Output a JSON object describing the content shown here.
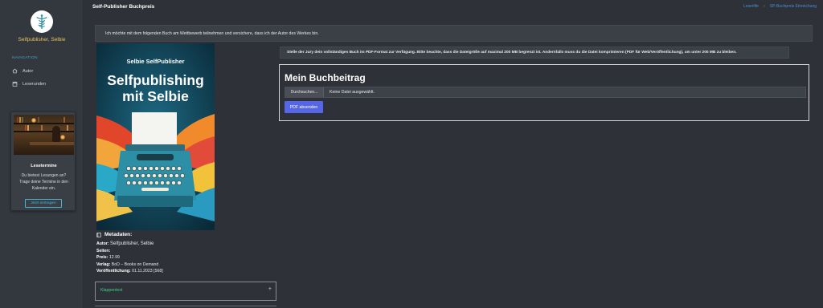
{
  "app": {
    "title": "Self-Publisher Buchpreis"
  },
  "breadcrumb": {
    "items": [
      "Leserlife",
      "SP-Buchpreis Einreichung"
    ]
  },
  "sidebar": {
    "username": "Selfpublisher, Selbie",
    "nav_title": "NAVIGATION",
    "items": [
      {
        "label": "Autor",
        "icon": "home-icon"
      },
      {
        "label": "Leserunden",
        "icon": "calendar-icon"
      }
    ],
    "card": {
      "title": "Lesetermine",
      "text": "Du bietest Lesungen an? Trage deine Termine in den Kalender ein.",
      "button": "Jetzt eintragen"
    }
  },
  "notice": "Ich möchte mit dem folgenden Buch am Wettbewerb teilnehmen und versichere, dass ich der Autor des Werkes bin.",
  "book": {
    "cover_author": "Selbie SelfPublisher",
    "cover_title": "Selfpublishing mit Selbie",
    "meta_heading": "Metadaten:",
    "fields": {
      "author_label": "Autor:",
      "author_value": "Selfpublisher, Selbie",
      "pages_label": "Seiten:",
      "pages_value": "",
      "price_label": "Preis:",
      "price_value": "12.99",
      "publisher_label": "Verlag:",
      "publisher_value": "BoD – Books on Demand",
      "published_label": "Veröffentlichung:",
      "published_value": "01.11.2023 [568]"
    },
    "klappentext_label": "Klappentext",
    "klappentext_toggle": "+"
  },
  "jury_note": "Stelle der Jury dein vollständiges Buch im PDF-Format zur Verfügung. Bitte beachte, dass die Dateigröße auf maximal 200 MB begrenzt ist. Andernfalls muss du die Datei komprimieren (PDF für Web/Veröffentlichung), um unter 200 MB zu bleiben.",
  "entry": {
    "title": "Mein Buchbeitrag",
    "browse_label": "Durchsuchen...",
    "file_status": "Keine Datei ausgewählt.",
    "submit_label": "PDF absenden"
  },
  "colors": {
    "background": "#2e3238",
    "sidebar": "#33383f",
    "accent_blue": "#5567e6",
    "username_gold": "#e8c25a",
    "link_blue": "#4a8cd6",
    "klappentext_green": "#3fd08a"
  }
}
